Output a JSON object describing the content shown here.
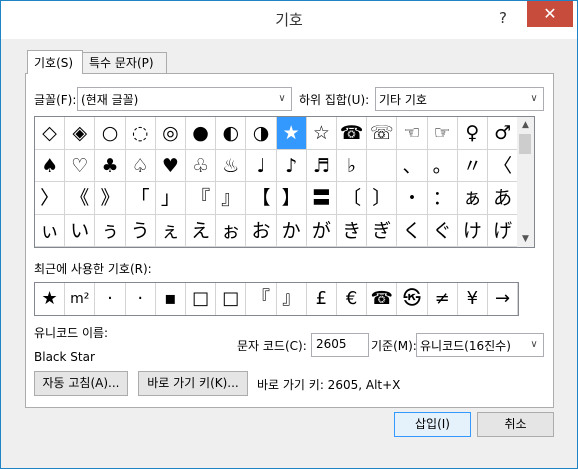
{
  "window": {
    "title": "기호",
    "help": "?",
    "close": "✕"
  },
  "tabs": [
    {
      "label": "기호(S)"
    },
    {
      "label": "특수 문자(P)"
    }
  ],
  "font": {
    "label": "글꼴(F):",
    "value": "(현재 글꼴)"
  },
  "subset": {
    "label": "하위 집합(U):",
    "value": "기타 기호"
  },
  "symbols": [
    [
      "◇",
      "◈",
      "○",
      "◌",
      "◎",
      "●",
      "◐",
      "◑",
      "★",
      "☆",
      "☎",
      "☏",
      "☜",
      "☞",
      "♀",
      "♂"
    ],
    [
      "♠",
      "♡",
      "♣",
      "♤",
      "♥",
      "♧",
      "♨",
      "♩",
      "♪",
      "♬",
      "♭",
      "",
      "、",
      "。",
      "〃",
      "〈"
    ],
    [
      "〉",
      "《",
      "》",
      "「",
      "」",
      "『",
      "』",
      "【",
      "】",
      "〓",
      "〔",
      "〕",
      "・",
      "：",
      "ぁ",
      "あ"
    ],
    [
      "ぃ",
      "い",
      "ぅ",
      "う",
      "ぇ",
      "え",
      "ぉ",
      "お",
      "か",
      "が",
      "き",
      "ぎ",
      "く",
      "ぐ",
      "け",
      "げ"
    ]
  ],
  "selected_symbol": "★",
  "recent": {
    "label": "최근에 사용한 기호(R):",
    "items": [
      "★",
      "m²",
      "·",
      "·",
      "▪",
      "□",
      "□",
      "『",
      "』",
      "£",
      "€",
      "☎",
      "㉿",
      "≠",
      "¥",
      "→"
    ]
  },
  "unicode_name": {
    "label": "유니코드 이름:",
    "value": "Black Star"
  },
  "char_code": {
    "label": "문자 코드(C):",
    "value": "2605"
  },
  "base": {
    "label": "기준(M):",
    "value": "유니코드(16진수)"
  },
  "buttons": {
    "autocorrect": "자동 고침(A)...",
    "shortcut": "바로 가기 키(K)...",
    "insert": "삽입(I)",
    "cancel": "취소"
  },
  "shortcut_text": "바로 가기 키: 2605, Alt+X"
}
